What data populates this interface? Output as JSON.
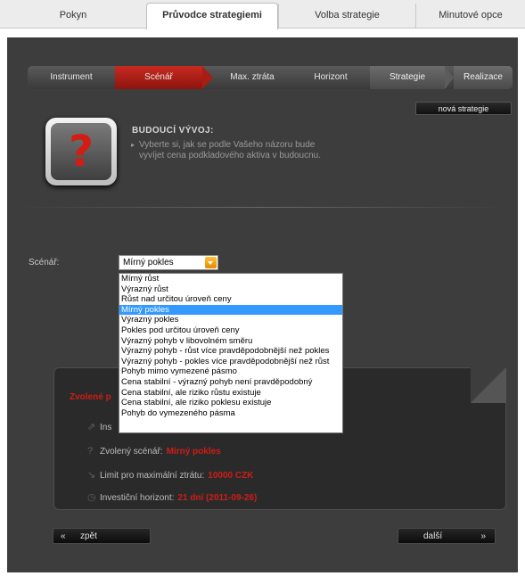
{
  "tabs": [
    {
      "label": "Pokyn"
    },
    {
      "label": "Průvodce strategiemi"
    },
    {
      "label": "Volba strategie"
    },
    {
      "label": "Minutové opce"
    }
  ],
  "steps": [
    {
      "label": "Instrument"
    },
    {
      "label": "Scénář"
    },
    {
      "label": "Max. ztráta"
    },
    {
      "label": "Horizont"
    },
    {
      "label": "Strategie"
    },
    {
      "label": "Realizace"
    }
  ],
  "new_strategy_label": "nová strategie",
  "step_info": {
    "icon": "question-mark-icon",
    "title": "BUDOUCÍ VÝVOJ:",
    "description": "Vyberte si, jak se podle Vašeho názoru bude vyvíjet cena podkladového aktiva v budoucnu."
  },
  "scenario": {
    "label": "Scénář:",
    "selected": "Mírný pokles",
    "options": [
      "Mírný růst",
      "Výrazný růst",
      "Růst nad určitou úroveň ceny",
      "Mírný pokles",
      "Výrazný pokles",
      "Pokles pod určitou úroveň ceny",
      "Výrazný pohyb v libovolném směru",
      "Výrazný pohyb - růst více pravděpodobnější než pokles",
      "Výrazný pohyb - pokles více pravděpodobnější než růst",
      "Pohyb mimo vymezené pásmo",
      "Cena stabilní - výrazný pohyb není pravděpodobný",
      "Cena stabilní, ale riziko růstu existuje",
      "Cena stabilní, ale riziko poklesu existuje",
      "Pohyb do vymezeného pásma"
    ]
  },
  "summary": {
    "title": "Zvolené p",
    "instrument_label": "Ins",
    "scenario_label": "Zvolený scénář:",
    "scenario_value": "Mírný pokles",
    "loss_label": "Limit pro maximální ztrátu:",
    "loss_value": "10000 CZK",
    "horizon_label": "Investiční horizont:",
    "horizon_value": "21 dní (2011-09-26)"
  },
  "nav": {
    "back_arrow": "«",
    "back_label": "zpět",
    "next_label": "další",
    "next_arrow": "»"
  },
  "colors": {
    "accent": "#cf1d16",
    "panel": "#3d3d3d",
    "selection": "#3399ff"
  }
}
